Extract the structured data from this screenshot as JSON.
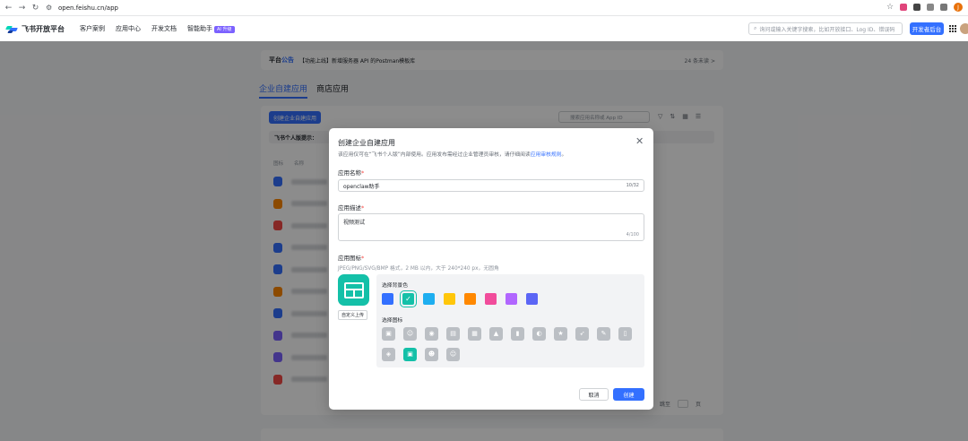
{
  "browser": {
    "url": "open.feishu.cn/app",
    "profile_initial": "J"
  },
  "header": {
    "brand": "飞书开放平台",
    "nav": [
      {
        "label": "客户案例"
      },
      {
        "label": "应用中心"
      },
      {
        "label": "开发文档"
      },
      {
        "label": "智能助手"
      }
    ],
    "ai_badge": "AI 升级",
    "search_placeholder": "询问或输入关键字搜索，比如开放接口、Log ID、错误码",
    "dev_console_button": "开发者后台"
  },
  "page": {
    "notice_title_prefix": "平台",
    "notice_title_suffix": "公告",
    "notice_text": "【功能上线】新增服务器 API 的Postman模板库",
    "notice_more": "24 条未读 >",
    "tabs": [
      {
        "label": "企业自建应用",
        "active": true
      },
      {
        "label": "商店应用",
        "active": false
      }
    ],
    "create_button": "创建企业自建应用",
    "list_search_placeholder": "搜索应用名称或 App ID",
    "tip_text": "飞书个人版提示：",
    "col_icon": "图标",
    "col_name": "名称",
    "app_icon_colors": [
      "#3370ff",
      "#ff8800",
      "#f54a45",
      "#3370ff",
      "#3370ff",
      "#ff8800",
      "#3370ff",
      "#7b61ff",
      "#7b61ff",
      "#f54a45"
    ],
    "pager_jump_label": "跳至",
    "pager_page_unit": "页"
  },
  "modal": {
    "title": "创建企业自建应用",
    "desc_text": "该应用仅可在“飞书个人版”内部使用。应用发布需经过企业管理员审核，请仔细阅读",
    "desc_link": "应用审核规则",
    "desc_end": "。",
    "name_label": "应用名称",
    "name_value": "openclaw助手",
    "name_count": "10/32",
    "desc_label": "应用描述",
    "desc_value": "视频测试",
    "desc_count": "4/100",
    "icon_label": "应用图标",
    "icon_hint": "JPEG/PNG/SVG/BMP 格式，2 MB 以内，大于 240*240 px，无圆角",
    "custom_upload": "自定义上传",
    "bg_color_label": "选择背景色",
    "bg_colors": [
      "#3370ff",
      "#14c0a8",
      "#1eaef0",
      "#ffc60a",
      "#ff8800",
      "#f14c9b",
      "#b166ff",
      "#5b65f5"
    ],
    "selected_color_index": 1,
    "icon_pick_label": "选择图标",
    "icons": [
      {
        "name": "box-icon",
        "glyph": "▣"
      },
      {
        "name": "robot-icon",
        "glyph": "☺"
      },
      {
        "name": "pin-icon",
        "glyph": "◉"
      },
      {
        "name": "document-icon",
        "glyph": "▤"
      },
      {
        "name": "calendar-icon",
        "glyph": "▦"
      },
      {
        "name": "bell-icon",
        "glyph": "▲"
      },
      {
        "name": "bookmark-icon",
        "glyph": "▮"
      },
      {
        "name": "moon-icon",
        "glyph": "◐"
      },
      {
        "name": "star-icon",
        "glyph": "★"
      },
      {
        "name": "rocket-icon",
        "glyph": "➶"
      },
      {
        "name": "wrench-icon",
        "glyph": "✎"
      },
      {
        "name": "file-icon",
        "glyph": "▯"
      },
      {
        "name": "shield-icon",
        "glyph": "◈"
      },
      {
        "name": "dashboard-icon",
        "glyph": "▣"
      },
      {
        "name": "people-icon",
        "glyph": "☻"
      },
      {
        "name": "smile-icon",
        "glyph": "☺"
      }
    ],
    "selected_icon_index": 13,
    "cancel_button": "取消",
    "create_button": "创建"
  }
}
